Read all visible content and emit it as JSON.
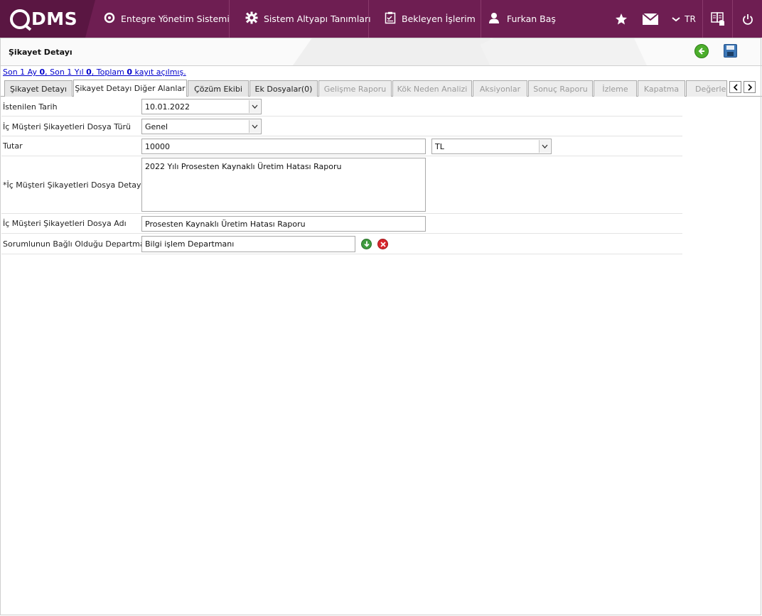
{
  "topbar": {
    "logo_text": "DMS",
    "nav1_label": "Entegre Yönetim Sistemi",
    "nav2_label": "Sistem Altyapı Tanımları",
    "nav3_label": "Bekleyen İşlerim",
    "user_name": "Furkan Baş",
    "lang": "TR",
    "icons": [
      "q-logo-icon",
      "gear-icon",
      "clipboard-icon",
      "user-icon",
      "star-icon",
      "mail-icon",
      "chevron-down-icon",
      "help-book-icon",
      "power-icon"
    ]
  },
  "page": {
    "title": "Şikayet Detayı"
  },
  "records": {
    "text_a": "Son 1 Ay ",
    "count_month": "0",
    "text_b": ", Son 1 Yıl ",
    "count_year": "0",
    "text_c": ", Toplam ",
    "count_total": "0",
    "text_d": " kayıt açılmış."
  },
  "tabs": [
    {
      "label": "Şikayet Detayı",
      "state": "normal"
    },
    {
      "label": "Şikayet Detayı Diğer Alanlar",
      "state": "active"
    },
    {
      "label": "Çözüm Ekibi",
      "state": "normal"
    },
    {
      "label": "Ek Dosyalar(0)",
      "state": "normal"
    },
    {
      "label": "Gelişme Raporu",
      "state": "disabled"
    },
    {
      "label": "Kök Neden Analizi",
      "state": "disabled"
    },
    {
      "label": "Aksiyonlar",
      "state": "disabled"
    },
    {
      "label": "Sonuç Raporu",
      "state": "disabled"
    },
    {
      "label": "İzleme",
      "state": "disabled"
    },
    {
      "label": "Kapatma",
      "state": "disabled"
    },
    {
      "label": "Değerler",
      "state": "disabled"
    }
  ],
  "form": {
    "requested_date_label": "İstenilen Tarih",
    "requested_date_value": "10.01.2022",
    "file_type_label": "İç Müşteri Şikayetleri Dosya Türü",
    "file_type_value": "Genel",
    "amount_label": "Tutar",
    "amount_value": "10000",
    "currency_value": "TL",
    "detail_label": "*İç Müşteri Şikayetleri Dosya Detayı",
    "detail_value": "2022 Yılı Prosesten Kaynaklı Üretim Hatası Raporu",
    "file_name_label": "İç Müşteri Şikayetleri Dosya Adı",
    "file_name_value": "Prosesten Kaynaklı Üretim Hatası Raporu",
    "department_label": "Sorumlunun Bağlı Olduğu Departman",
    "department_value": "Bilgi işlem Departmanı"
  },
  "colors": {
    "topbar": "#6e1e52",
    "logo_bg": "#5a1642",
    "back_button": "#4cae2c",
    "save_button": "#3d78b8",
    "add_button": "#3e9a3e",
    "delete_button": "#d8262c",
    "link": "#0000cc"
  }
}
